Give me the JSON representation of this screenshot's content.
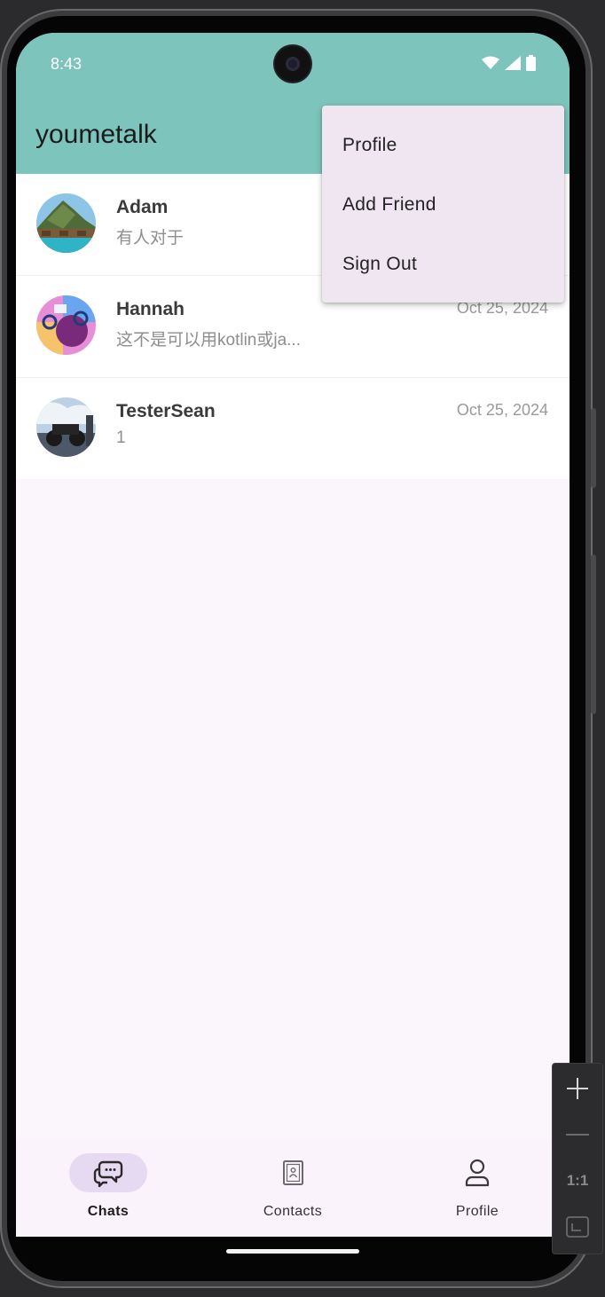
{
  "status_bar": {
    "time": "8:43"
  },
  "app_bar": {
    "title": "youmetalk"
  },
  "menu": {
    "items": [
      {
        "label": "Profile"
      },
      {
        "label": "Add Friend"
      },
      {
        "label": "Sign Out"
      }
    ]
  },
  "chats": [
    {
      "name": "Adam",
      "preview": "有人对于",
      "date": ""
    },
    {
      "name": "Hannah",
      "preview": "这不是可以用kotlin或ja...",
      "date": "Oct 25, 2024"
    },
    {
      "name": "TesterSean",
      "preview": "1",
      "date": "Oct 25, 2024"
    }
  ],
  "bottom_nav": {
    "items": [
      {
        "label": "Chats",
        "icon": "chat-bubbles-icon",
        "active": true
      },
      {
        "label": "Contacts",
        "icon": "contacts-book-icon",
        "active": false
      },
      {
        "label": "Profile",
        "icon": "person-icon",
        "active": false
      }
    ]
  },
  "zoom_toolbar": {
    "actual_size_label": "1:1"
  },
  "colors": {
    "app_bar": "#7dc4bc",
    "menu_bg": "#efe6f2",
    "nav_pill": "#e6daf2",
    "background": "#fbf5fc"
  }
}
